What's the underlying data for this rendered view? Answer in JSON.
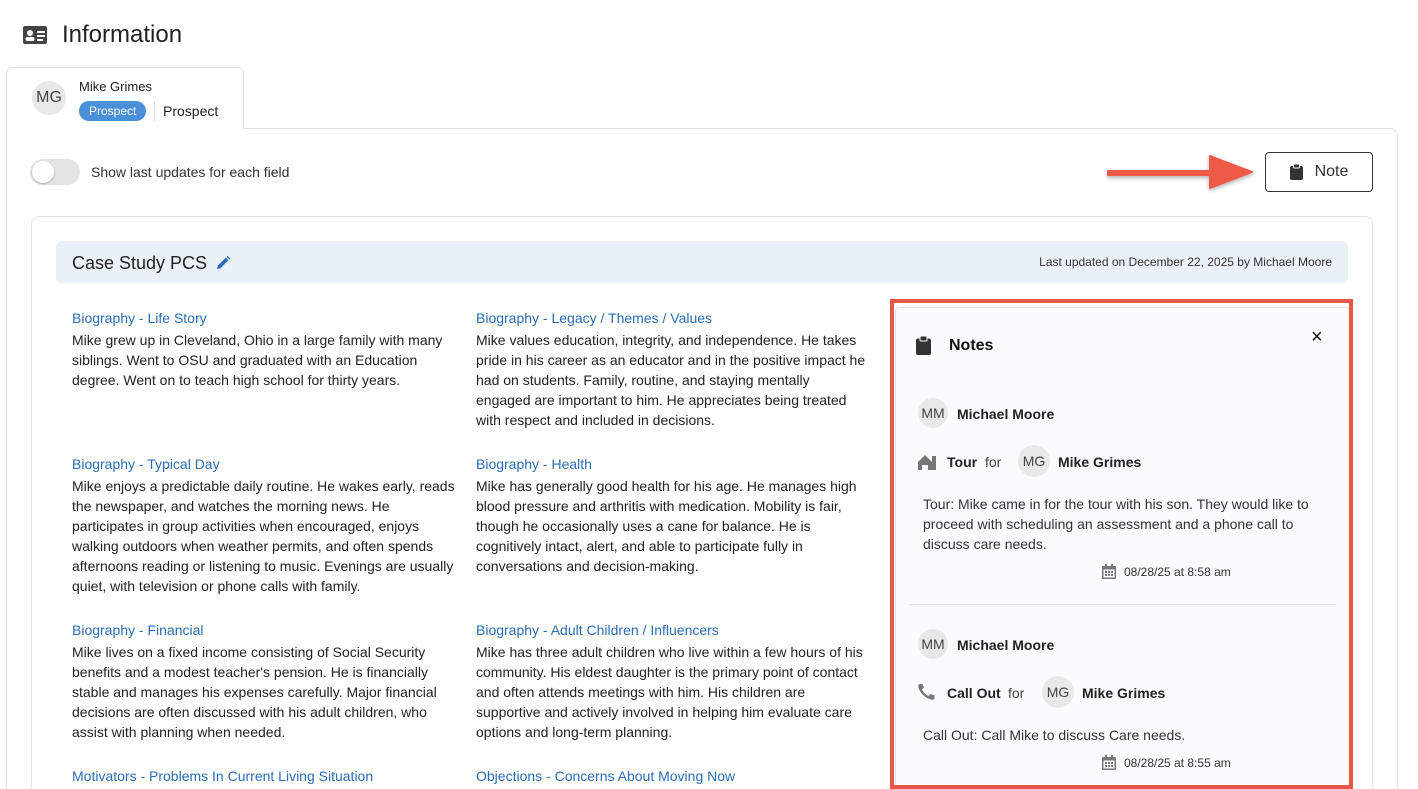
{
  "header": {
    "title": "Information",
    "icon": "id-card-icon"
  },
  "contact": {
    "initials": "MG",
    "name": "Mike Grimes",
    "badge": "Prospect",
    "status": "Prospect"
  },
  "toolbar": {
    "toggle_label": "Show last updates for each field",
    "toggle_on": false,
    "note_button": "Note"
  },
  "card": {
    "title": "Case Study PCS",
    "updated": "Last updated on December 22, 2025 by Michael Moore",
    "fields": [
      {
        "label": "Biography - Life Story",
        "text": "Mike grew up in Cleveland, Ohio in a large family with many siblings. Went to OSU and graduated with an Education degree. Went on to teach high school for thirty years."
      },
      {
        "label": "Biography - Legacy / Themes / Values",
        "text": "Mike values education, integrity, and independence. He takes pride in his career as an educator and in the positive impact he had on students. Family, routine, and staying mentally engaged are important to him. He appreciates being treated with respect and included in decisions."
      },
      {
        "label": "Biography - Typical Day",
        "text": "Mike enjoys a predictable daily routine. He wakes early, reads the newspaper, and watches the morning news. He participates in group activities when encouraged, enjoys walking outdoors when weather permits, and often spends afternoons reading or listening to music. Evenings are usually quiet, with television or phone calls with family."
      },
      {
        "label": "Biography - Health",
        "text": "Mike has generally good health for his age. He manages high blood pressure and arthritis with medication. Mobility is fair, though he occasionally uses a cane for balance. He is cognitively intact, alert, and able to participate fully in conversations and decision-making."
      },
      {
        "label": "Biography - Financial",
        "text": "Mike lives on a fixed income consisting of Social Security benefits and a modest teacher's pension. He is financially stable and manages his expenses carefully. Major financial decisions are often discussed with his adult children, who assist with planning when needed."
      },
      {
        "label": "Biography - Adult Children / Influencers",
        "text": "Mike has three adult children who live within a few hours of his community. His eldest daughter is the primary point of contact and often attends meetings with him. His children are supportive and actively involved in helping him evaluate care options and long-term planning."
      },
      {
        "label": "Motivators - Problems In Current Living Situation",
        "text": ""
      },
      {
        "label": "Objections - Concerns About Moving Now",
        "text": ""
      }
    ]
  },
  "notes_panel": {
    "title": "Notes",
    "close": "×",
    "items": [
      {
        "author_initials": "MM",
        "author": "Michael Moore",
        "type": "Tour",
        "type_icon": "house-icon",
        "for_text": "for",
        "for_initials": "MG",
        "for_name": "Mike Grimes",
        "body": "Tour: Mike came in for the tour with his son. They would like to proceed with scheduling an assessment and a phone call to discuss care needs.",
        "date": "08/28/25 at 8:58 am"
      },
      {
        "author_initials": "MM",
        "author": "Michael Moore",
        "type": "Call Out",
        "type_icon": "phone-icon",
        "for_text": "for",
        "for_initials": "MG",
        "for_name": "Mike Grimes",
        "body": "Call Out: Call Mike to discuss Care needs.",
        "date": "08/28/25 at 8:55 am"
      }
    ]
  },
  "colors": {
    "link": "#2a6db5",
    "badge": "#4a90d9",
    "header_bg": "#eaf0f7",
    "highlight": "#e8584a",
    "arrow": "#ef5a47"
  }
}
